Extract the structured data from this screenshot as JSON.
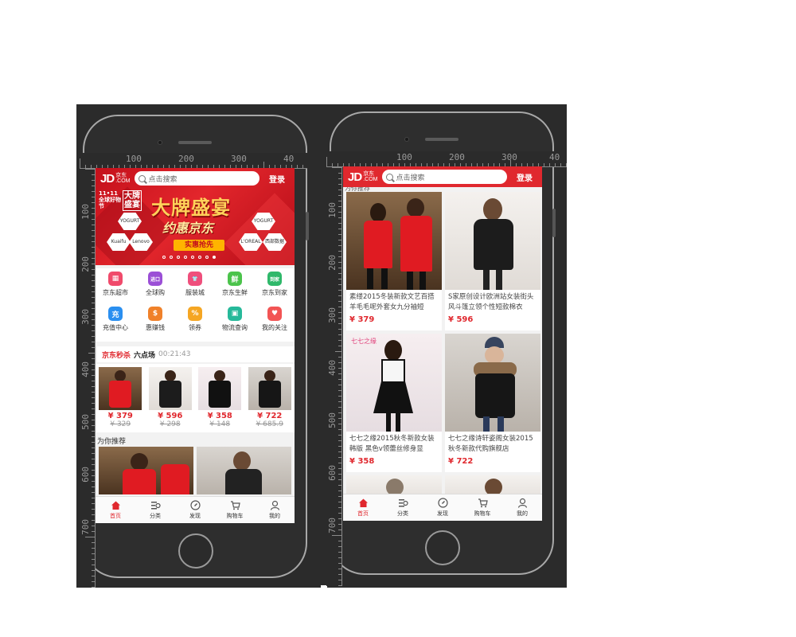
{
  "ruler": {
    "h_labels": [
      "100",
      "200",
      "300",
      "40"
    ],
    "v_labels": [
      "100",
      "200",
      "300",
      "400",
      "500",
      "600",
      "700"
    ]
  },
  "screen1": {
    "header": {
      "logo": "JD",
      "logo_sub": "京东\n.COM",
      "search_placeholder": "点击搜索",
      "login": "登录"
    },
    "banner": {
      "badge_1111": "11•11 全球好物节",
      "badge_big": "大牌\n盛宴",
      "title": "大牌盛宴",
      "subtitle": "约惠京东",
      "button": "实惠抢先",
      "brands": [
        "Lenovo",
        "Kuaifu",
        "L'OREAL",
        "西部数据",
        "YOGURT"
      ],
      "dots": 8,
      "active_dot": 7
    },
    "icons": [
      {
        "label": "京东超市",
        "color": "#f04a6b",
        "glyph": "▦"
      },
      {
        "label": "全球购",
        "color": "#9b4fd6",
        "glyph": "进口"
      },
      {
        "label": "服装城",
        "color": "#ef4f7c",
        "glyph": "👕"
      },
      {
        "label": "京东生鲜",
        "color": "#4bc34b",
        "glyph": "鲜"
      },
      {
        "label": "京东到家",
        "color": "#2fb86a",
        "glyph": "到家"
      },
      {
        "label": "充值中心",
        "color": "#2a8ff0",
        "glyph": "充"
      },
      {
        "label": "惠赚钱",
        "color": "#f0812a",
        "glyph": "$"
      },
      {
        "label": "领券",
        "color": "#f5a623",
        "glyph": "%"
      },
      {
        "label": "物流查询",
        "color": "#26b99a",
        "glyph": "▣"
      },
      {
        "label": "我的关注",
        "color": "#f25454",
        "glyph": "♥"
      }
    ],
    "flash": {
      "title": "京东秒杀",
      "session": "六点场",
      "countdown": "00:21:43"
    },
    "flash_items": [
      {
        "price": "¥ 379",
        "old": "¥ 329"
      },
      {
        "price": "¥ 596",
        "old": "¥ 298"
      },
      {
        "price": "¥ 358",
        "old": "¥ 148"
      },
      {
        "price": "¥ 722",
        "old": "¥ 685.9"
      }
    ],
    "recommend_label": "为你推荐"
  },
  "screen2": {
    "header": {
      "logo": "JD",
      "logo_sub": "京东\n.COM",
      "search_placeholder": "点击搜索",
      "login": "登录"
    },
    "recommend_label": "为你推荐",
    "products": [
      {
        "desc": "素缕2015冬装新款文艺百搭羊毛毛呢外套女九分袖短",
        "price": "¥ 379"
      },
      {
        "desc": "S家原创设计欧洲站女装街头风斗篷立领个性短款棉衣",
        "price": "¥ 596"
      },
      {
        "desc": "七七之缘2015秋冬新款女装韩版 黑色v领蕾丝修身显",
        "price": "¥ 358"
      },
      {
        "desc": "七七之缘诗轩姿阁女装2015秋冬新款代购旗舰店",
        "price": "¥ 722"
      }
    ]
  },
  "tabbar": [
    {
      "label": "首页",
      "active": true
    },
    {
      "label": "分类",
      "active": false
    },
    {
      "label": "发现",
      "active": false
    },
    {
      "label": "购物车",
      "active": false
    },
    {
      "label": "我的",
      "active": false
    }
  ],
  "colors": {
    "brand_red": "#e0282e",
    "price_red": "#e0282e",
    "background": "#2b2b2b"
  }
}
